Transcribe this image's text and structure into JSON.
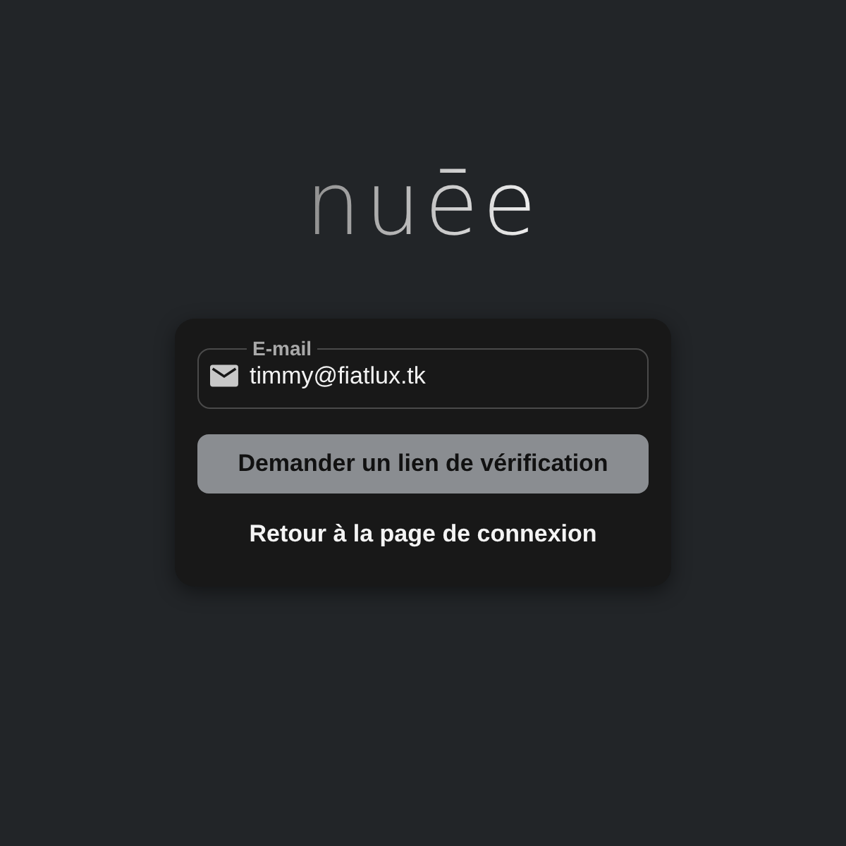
{
  "logo": {
    "text": "nuēe"
  },
  "form": {
    "email_field": {
      "label": "E-mail",
      "value": "timmy@fiatlux.tk"
    },
    "submit_button": {
      "label": "Demander un lien de vérification",
      "disabled": true
    },
    "back_link": {
      "label": "Retour à la page de connexion"
    }
  }
}
